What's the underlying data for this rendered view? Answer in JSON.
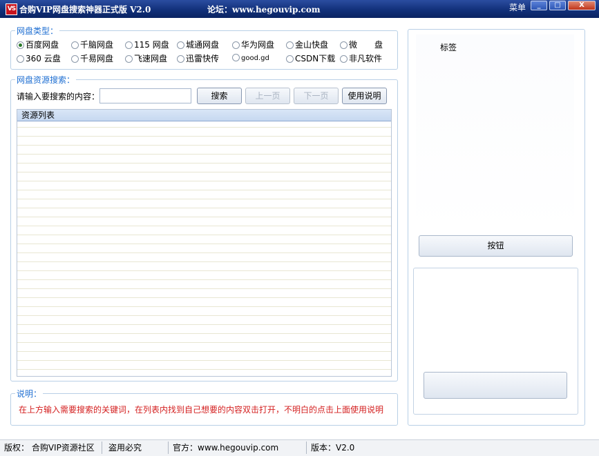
{
  "window": {
    "icon_text": "VS",
    "title": "合购VIP网盘搜索神器正式版 V2.0",
    "forum": "论坛：www.hegouvip.com",
    "menu": "菜单",
    "minimize": "_",
    "maximize": "□",
    "close": "X"
  },
  "disk_type": {
    "legend": "网盘类型：",
    "row1": [
      "百度网盘",
      "千脑网盘",
      "115 网盘",
      "城通网盘",
      "华为网盘",
      "金山快盘",
      "微",
      "盘"
    ],
    "row2": [
      "360 云盘",
      "千易网盘",
      "飞速网盘",
      "迅雷快传",
      "good.gd",
      "CSDN下载",
      "非凡软件"
    ],
    "selected": "百度网盘"
  },
  "search": {
    "legend": "网盘资源搜索：",
    "prompt": "请输入要搜索的内容：",
    "input_value": "",
    "search_button": "搜索",
    "prev_button": "上一页",
    "next_button": "下一页",
    "help_button": "使用说明",
    "list_header": "资源列表"
  },
  "note": {
    "legend": "说明：",
    "text": "在上方输入需要搜索的关键词，在列表内找到自己想要的内容双击打开，不明白的点击上面使用说明"
  },
  "right": {
    "label": "标签",
    "button": "按钮",
    "button2": ""
  },
  "status": {
    "copyright": "版权：  合购VIP资源社区",
    "piracy": "盗用必究",
    "official": "官方：www.hegouvip.com",
    "version": "版本：V2.0"
  },
  "colors": {
    "titlebar": "#12317a",
    "legend": "#1f6fd2",
    "note_text": "#d42020"
  }
}
